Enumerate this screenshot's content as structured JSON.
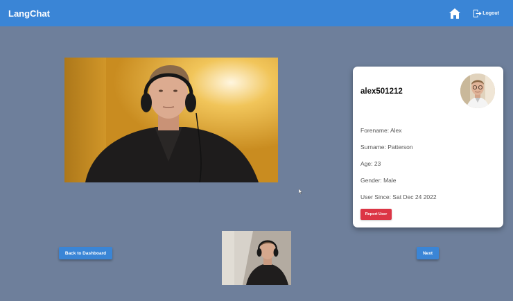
{
  "navbar": {
    "brand": "LangChat",
    "home_icon": "home-icon",
    "logout_icon": "logout-icon",
    "logout_label": "Logout",
    "color": "#3a85d6"
  },
  "profile": {
    "username": "alex501212",
    "forename": "Forename: Alex",
    "surname": "Surname: Patterson",
    "age": "Age: 23",
    "gender": "Gender: Male",
    "user_since": "User Since: Sat Dec 24 2022",
    "report_label": "Report User",
    "report_color": "#dc3545"
  },
  "controls": {
    "back_label": "Back to Dashboard",
    "next_label": "Next"
  },
  "background_color": "#6e7f9b"
}
